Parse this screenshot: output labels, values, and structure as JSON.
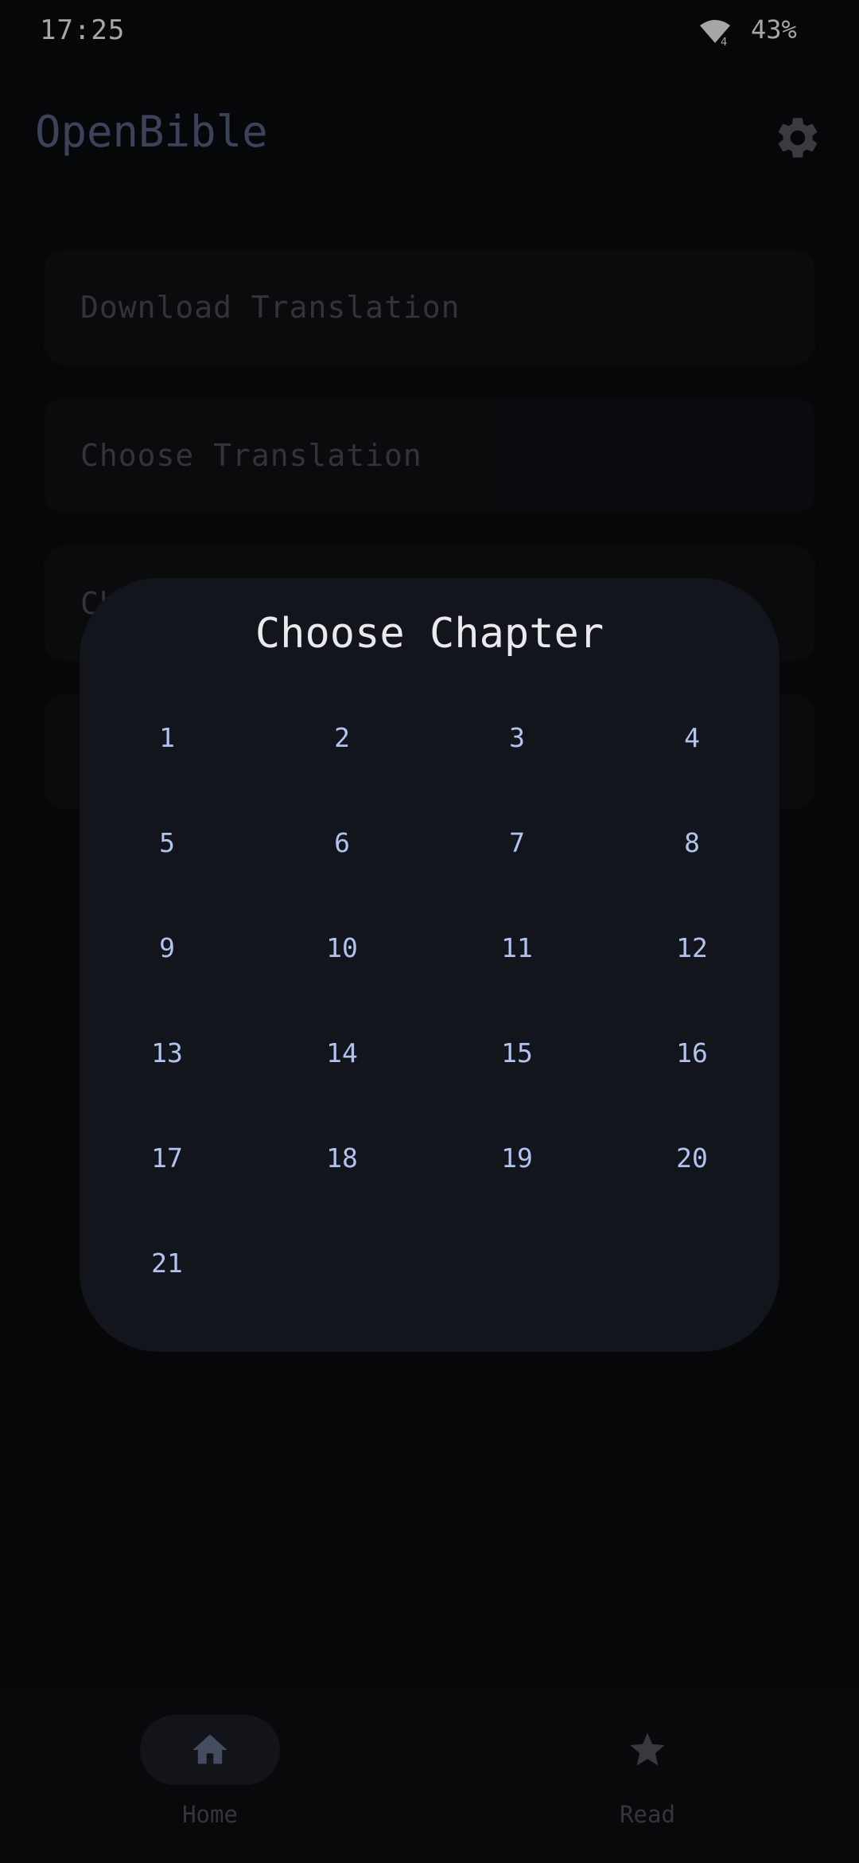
{
  "status_bar": {
    "time": "17:25",
    "wifi_icon": "wifi-icon",
    "wifi_badge": "4",
    "battery": "43%"
  },
  "app_bar": {
    "title": "OpenBible",
    "settings_icon": "gear-icon"
  },
  "menu": {
    "items": [
      {
        "label": "Download Translation"
      },
      {
        "label": "Choose Translation"
      },
      {
        "label": "Ch"
      },
      {
        "label": ""
      }
    ]
  },
  "dialog": {
    "title": "Choose Chapter",
    "chapters": [
      "1",
      "2",
      "3",
      "4",
      "5",
      "6",
      "7",
      "8",
      "9",
      "10",
      "11",
      "12",
      "13",
      "14",
      "15",
      "16",
      "17",
      "18",
      "19",
      "20",
      "21"
    ]
  },
  "bottom_nav": {
    "items": [
      {
        "label": "Home",
        "icon": "home-icon",
        "active": true
      },
      {
        "label": "Read",
        "icon": "star-icon",
        "active": false
      }
    ]
  },
  "colors": {
    "background": "#0a0b0e",
    "dialog_bg": "#13151c",
    "chapter_text": "#b3c3ef",
    "title_accent": "#5d6889"
  }
}
